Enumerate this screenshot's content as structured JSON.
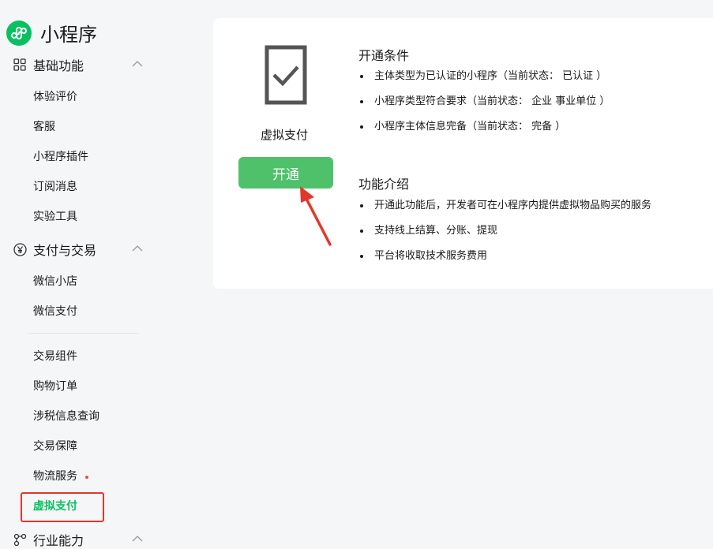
{
  "brand": {
    "title": "小程序"
  },
  "sidebar": {
    "groups": [
      {
        "label": "基础功能",
        "items": [
          "体验评价",
          "客服",
          "小程序插件",
          "订阅消息",
          "实验工具"
        ]
      },
      {
        "label": "支付与交易",
        "items": [
          "微信小店",
          "微信支付",
          "交易组件",
          "购物订单",
          "涉税信息查询",
          "交易保障",
          "物流服务",
          "虚拟支付"
        ]
      },
      {
        "label": "行业能力"
      }
    ]
  },
  "service": {
    "name": "虚拟支付",
    "open_label": "开通",
    "conditions_title": "开通条件",
    "conditions": [
      "主体类型为已认证的小程序（当前状态： 已认证 ）",
      "小程序类型符合要求（当前状态： 企业 事业单位 ）",
      "小程序主体信息完备（当前状态： 完备 ）"
    ],
    "intro_title": "功能介绍",
    "intro": [
      "开通此功能后，开发者可在小程序内提供虚拟物品购买的服务",
      "支持线上结算、分账、提现",
      "平台将收取技术服务费用"
    ]
  },
  "colors": {
    "accent": "#07c160",
    "button": "#4fc16b",
    "highlight": "#e0382b",
    "notice_dot": "#e34d59"
  },
  "icons": {
    "brand": "mini-program-logo-icon",
    "group_basic": "grid-icon",
    "group_pay": "yen-icon",
    "group_industry": "nodes-icon",
    "service": "checkbox-icon"
  }
}
